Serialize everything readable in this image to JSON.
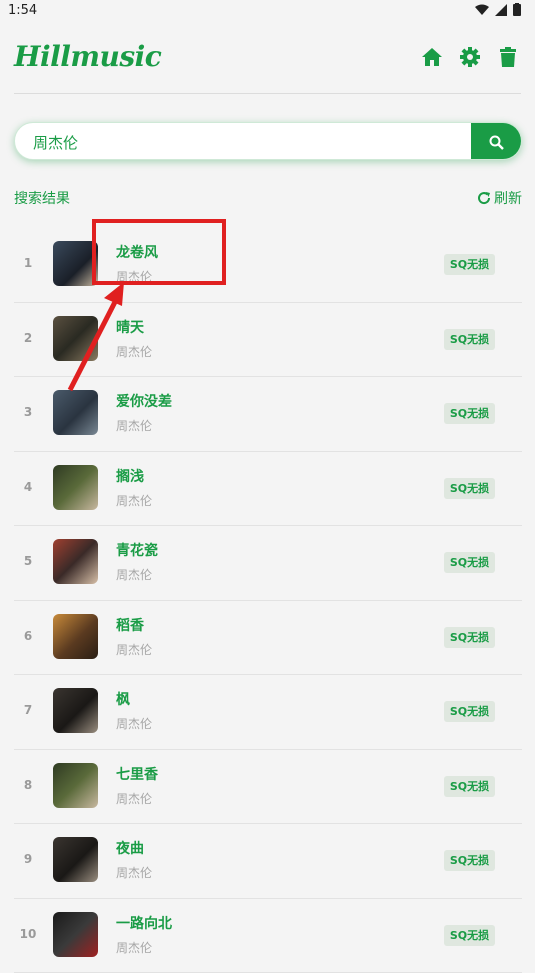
{
  "status_bar": {
    "time": "1:54"
  },
  "app": {
    "logo": "Hillmusic"
  },
  "search": {
    "value": "周杰伦"
  },
  "results": {
    "label": "搜索结果",
    "refresh_label": "刷新"
  },
  "songs": [
    {
      "index": "1",
      "title": "龙卷风",
      "artist": "周杰伦",
      "quality": "SQ无损"
    },
    {
      "index": "2",
      "title": "晴天",
      "artist": "周杰伦",
      "quality": "SQ无损"
    },
    {
      "index": "3",
      "title": "爱你没差",
      "artist": "周杰伦",
      "quality": "SQ无损"
    },
    {
      "index": "4",
      "title": "搁浅",
      "artist": "周杰伦",
      "quality": "SQ无损"
    },
    {
      "index": "5",
      "title": "青花瓷",
      "artist": "周杰伦",
      "quality": "SQ无损"
    },
    {
      "index": "6",
      "title": "稻香",
      "artist": "周杰伦",
      "quality": "SQ无损"
    },
    {
      "index": "7",
      "title": "枫",
      "artist": "周杰伦",
      "quality": "SQ无损"
    },
    {
      "index": "8",
      "title": "七里香",
      "artist": "周杰伦",
      "quality": "SQ无损"
    },
    {
      "index": "9",
      "title": "夜曲",
      "artist": "周杰伦",
      "quality": "SQ无损"
    },
    {
      "index": "10",
      "title": "一路向北",
      "artist": "周杰伦",
      "quality": "SQ无损"
    }
  ],
  "colors": {
    "accent": "#1a9c46",
    "annotation": "#e02020"
  }
}
